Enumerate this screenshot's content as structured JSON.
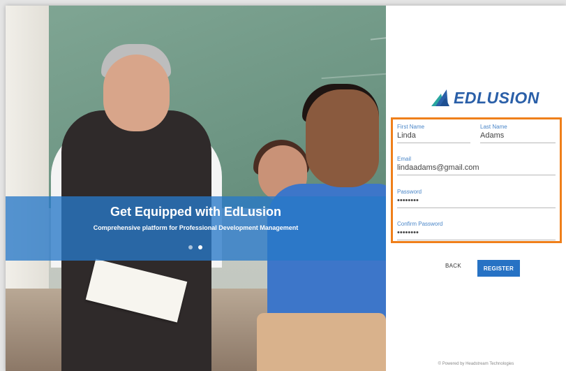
{
  "hero": {
    "title": "Get Equipped with EdLusion",
    "subtitle": "Comprehensive platform for Professional Development Management",
    "slide_count": 2,
    "active_slide": 2
  },
  "logo": {
    "text": "EDLUSION",
    "icon": "edlusion-wing-icon",
    "color": "#2a5fa8"
  },
  "form": {
    "border_color": "#ef7f1a",
    "first_name": {
      "label": "First Name",
      "value": "Linda"
    },
    "last_name": {
      "label": "Last Name",
      "value": "Adams"
    },
    "email": {
      "label": "Email",
      "value": "lindaadams@gmail.com"
    },
    "password": {
      "label": "Password",
      "value": "••••••••"
    },
    "confirm_password": {
      "label": "Confirm Password",
      "value": "••••••••"
    }
  },
  "actions": {
    "back_label": "BACK",
    "register_label": "REGISTER",
    "register_color": "#2772c4"
  },
  "footer": {
    "text": "© Powered by Headstream Technologies"
  }
}
